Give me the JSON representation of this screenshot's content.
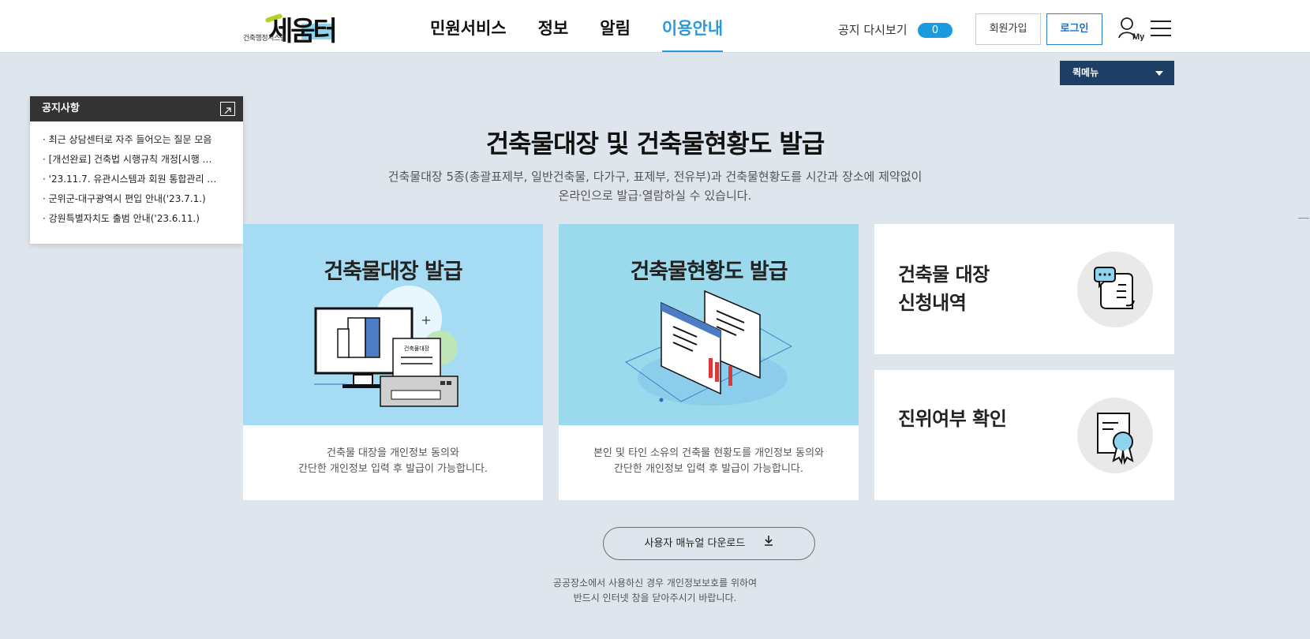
{
  "header": {
    "logo_sub": "건축행정시스템",
    "logo_main": "세움터",
    "nav": [
      {
        "label": "민원서비스",
        "active": false
      },
      {
        "label": "정보",
        "active": false
      },
      {
        "label": "알림",
        "active": false
      },
      {
        "label": "이용안내",
        "active": true
      }
    ],
    "notice_replay_label": "공지 다시보기",
    "notice_replay_count": "0",
    "join_label": "회원가입",
    "login_label": "로그인",
    "my_label": "My"
  },
  "quick_menu": {
    "label": "퀵메뉴"
  },
  "notice_popup": {
    "title": "공지사항",
    "items": [
      "최근 상담센터로 자주 들어오는 질문 모음",
      "[개선완료] 건축법 시행규칙 개정[시행 …",
      "'23.11.7. 유관시스템과 회원 통합관리 …",
      "군위군-대구광역시 편입 안내('23.7.1.)",
      "강원특별자치도 출범 안내('23.6.11.)"
    ]
  },
  "main": {
    "title": "건축물대장 및 건축물현황도 발급",
    "desc_line1": "건축물대장 5종(총괄표제부, 일반건축물, 다가구, 표제부, 전유부)과 건축물현황도를 시간과 장소에 제약없이",
    "desc_line2": "온라인으로 발급·열람하실 수 있습니다."
  },
  "cards": [
    {
      "title": "건축물대장 발급",
      "art_label": "건축물대장",
      "desc_line1": "건축물 대장을 개인정보 동의와",
      "desc_line2": "간단한 개인정보 입력 후 발급이 가능합니다.",
      "bg": "#a5dcf4"
    },
    {
      "title": "건축물현황도 발급",
      "desc_line1": "본인 및 타인 소유의 건축물 현황도를 개인정보 동의와",
      "desc_line2": "간단한 개인정보 입력 후 발급이 가능합니다.",
      "bg": "#9bd9ec"
    }
  ],
  "side_cards": [
    {
      "title_line1": "건축물 대장",
      "title_line2": "신청내역",
      "icon": "document-chat-icon"
    },
    {
      "title_line1": "진위여부 확인",
      "icon": "certificate-icon"
    }
  ],
  "download": {
    "label": "사용자 매뉴얼 다운로드",
    "icon": "download-icon"
  },
  "footnote": {
    "line1": "공공장소에서 사용하신 경우 개인정보보호를 위하여",
    "line2": "반드시 인터넷 창을 닫아주시기 바랍니다."
  },
  "colors": {
    "accent": "#2b9ad8",
    "quick_menu_bg": "#1d3e65",
    "page_bg": "#dfe5ec"
  }
}
